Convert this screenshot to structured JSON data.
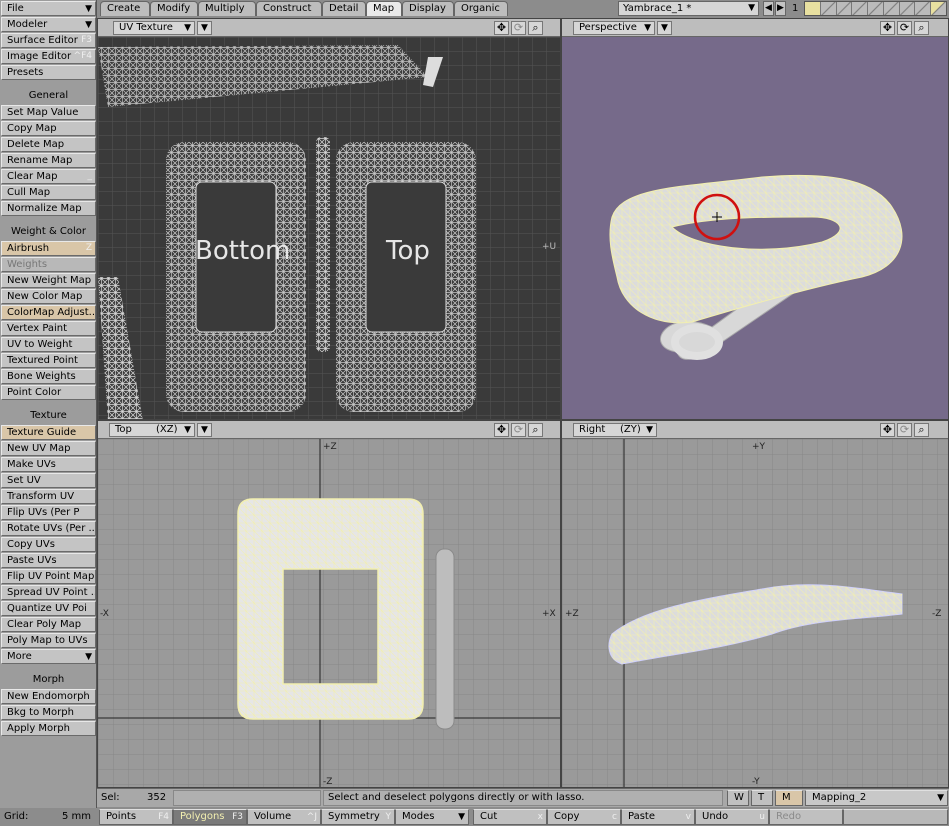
{
  "left_panel": {
    "file": "File",
    "modeler": "Modeler",
    "surface_editor": "Surface Editor",
    "surface_editor_key": "F3",
    "image_editor": "Image Editor",
    "image_editor_key": "^F4",
    "presets": "Presets",
    "sections": {
      "general": {
        "title": "General",
        "items": [
          "Set Map Value",
          "Copy Map",
          "Delete Map",
          "Rename Map",
          "Clear Map",
          "Cull Map",
          "Normalize Map"
        ],
        "clear_map_key": "_"
      },
      "weight_color": {
        "title": "Weight & Color",
        "items": [
          "Airbrush",
          "Weights",
          "New Weight Map",
          "New Color Map",
          "ColorMap Adjust...",
          "Vertex Paint",
          "UV to Weight",
          "Textured Point",
          "Bone Weights",
          "Point Color"
        ],
        "airbrush_key": "Z"
      },
      "texture": {
        "title": "Texture",
        "items": [
          "Texture Guide",
          "New UV Map",
          "Make UVs",
          "Set UV",
          "Transform UV",
          "Flip UVs (Per P",
          "Rotate UVs (Per ...",
          "Copy UVs",
          "Paste UVs",
          "Flip UV Point Map",
          "Spread UV Point ...",
          "Quantize UV Poi",
          "Clear Poly Map",
          "Poly Map to UVs"
        ],
        "more": "More"
      },
      "morph": {
        "title": "Morph",
        "items": [
          "New Endomorph",
          "Bkg to Morph",
          "Apply Morph"
        ]
      }
    }
  },
  "tabs": [
    "Create",
    "Modify",
    "Multiply",
    "Construct",
    "Detail",
    "Map",
    "Display",
    "Organic"
  ],
  "active_tab": "Map",
  "object_selector": "Yambrace_1 *",
  "layer_number": "1",
  "viewports": {
    "uv": {
      "mode": "UV Texture",
      "label_u": "+U",
      "text_bottom": "Bottom",
      "text_top": "Top"
    },
    "perspective": {
      "mode": "Perspective"
    },
    "top": {
      "mode": "Top",
      "axes": "(XZ)",
      "pz": "+Z",
      "nz": "-Z",
      "px": "+X",
      "nx": "-X"
    },
    "right": {
      "mode": "Right",
      "axes": "(ZY)",
      "py": "+Y",
      "ny": "-Y",
      "pz": "+Z",
      "nz": "-Z"
    }
  },
  "status": {
    "sel_label": "Sel:",
    "sel_value": "352",
    "message": "Select and deselect polygons directly or with lasso.",
    "w": "W",
    "t": "T",
    "m": "M",
    "map": "Mapping_2"
  },
  "bottom_bar": {
    "grid_label": "Grid:",
    "grid_value": "5 mm",
    "points": "Points",
    "points_key": "F4",
    "polygons": "Polygons",
    "polygons_key": "F3",
    "volume": "Volume",
    "volume_key": "^J",
    "symmetry": "Symmetry",
    "symmetry_key": "Y",
    "modes": "Modes",
    "cut": "Cut",
    "cut_key": "x",
    "copy": "Copy",
    "copy_key": "c",
    "paste": "Paste",
    "paste_key": "v",
    "undo": "Undo",
    "undo_key": "u",
    "redo": "Redo"
  },
  "colors": {
    "perspective_bg": "#766a8a",
    "viewport_bg": "#9a9a9a",
    "uv_bg": "#3a3a3a",
    "wire_yellow": "#f2efb0",
    "highlight_circle": "#d01010"
  }
}
